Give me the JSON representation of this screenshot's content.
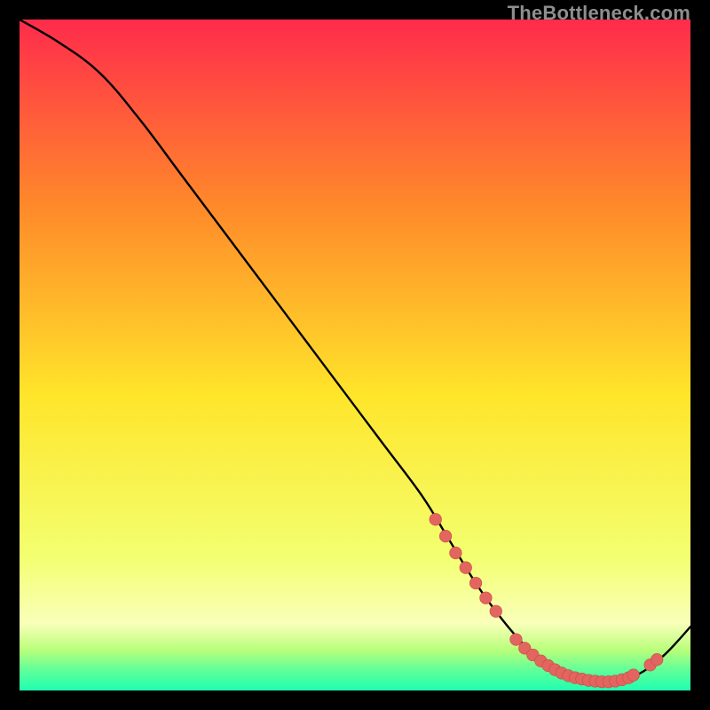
{
  "watermark": "TheBottleneck.com",
  "colors": {
    "bg": "#000000",
    "grad_top": "#ff2b4c",
    "grad_mid_upper": "#ff8a2a",
    "grad_mid": "#ffe52a",
    "grad_lower": "#f3ff70",
    "grad_green1": "#b8ff7a",
    "grad_green2": "#5fff9a",
    "grad_green3": "#1fffb0",
    "curve": "#000000",
    "marker_fill": "#e3655f",
    "marker_stroke": "#c94a44"
  },
  "chart_data": {
    "type": "line",
    "title": "",
    "xlabel": "",
    "ylabel": "",
    "xlim": [
      0,
      100
    ],
    "ylim": [
      0,
      100
    ],
    "curve": {
      "x": [
        0,
        6,
        12,
        18,
        24,
        30,
        36,
        42,
        48,
        54,
        60,
        64,
        68,
        72,
        76,
        80,
        84,
        88,
        92,
        96,
        100
      ],
      "y": [
        100,
        96.5,
        92,
        85,
        77,
        69,
        61,
        53,
        45,
        37,
        29,
        22.5,
        16,
        10.5,
        6,
        3,
        1.6,
        1.2,
        2.3,
        5.2,
        9.5
      ]
    },
    "series": [
      {
        "name": "markers-descent",
        "x": [
          62.0,
          63.5,
          65.0,
          66.5,
          68.0,
          69.5,
          71.0
        ],
        "y": [
          25.5,
          23.0,
          20.5,
          18.3,
          16.0,
          13.8,
          11.8
        ]
      },
      {
        "name": "markers-valley",
        "x": [
          74.0,
          75.3,
          76.5,
          77.7,
          78.8,
          79.8,
          80.8,
          81.8,
          82.8,
          83.8,
          84.8,
          85.8,
          86.8,
          87.8,
          88.8,
          89.8,
          90.8,
          91.5
        ],
        "y": [
          7.6,
          6.3,
          5.3,
          4.4,
          3.7,
          3.1,
          2.6,
          2.2,
          1.9,
          1.7,
          1.5,
          1.4,
          1.3,
          1.3,
          1.4,
          1.6,
          1.9,
          2.3
        ]
      },
      {
        "name": "markers-ascent",
        "x": [
          94.0,
          95.0
        ],
        "y": [
          3.8,
          4.6
        ]
      }
    ]
  }
}
